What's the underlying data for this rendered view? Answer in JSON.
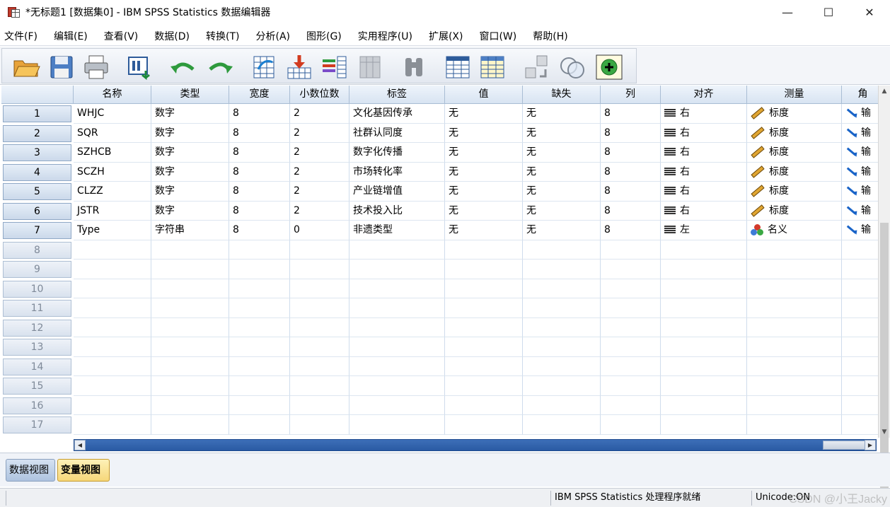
{
  "window": {
    "title": "*无标题1 [数据集0] - IBM SPSS Statistics 数据编辑器",
    "minimize": "—",
    "maximize": "☐",
    "close": "✕"
  },
  "menu": [
    "文件(F)",
    "编辑(E)",
    "查看(V)",
    "数据(D)",
    "转换(T)",
    "分析(A)",
    "图形(G)",
    "实用程序(U)",
    "扩展(X)",
    "窗口(W)",
    "帮助(H)"
  ],
  "toolbar": {
    "icons": [
      "open-folder-icon",
      "save-icon",
      "print-icon",
      "recall-dialog-icon",
      "undo-icon",
      "redo-icon",
      "goto-case-icon",
      "goto-variable-icon",
      "variables-icon",
      "run-descriptives-icon",
      "find-icon",
      "insert-cases-icon",
      "insert-variable-icon",
      "split-file-icon",
      "weight-cases-icon",
      "select-cases-icon",
      "value-labels-icon",
      "use-variable-sets-icon"
    ]
  },
  "grid": {
    "columns": [
      "名称",
      "类型",
      "宽度",
      "小数位数",
      "标签",
      "值",
      "缺失",
      "列",
      "对齐",
      "测量",
      "角"
    ],
    "rows": [
      {
        "num": "1",
        "name": "WHJC",
        "type": "数字",
        "width": "8",
        "decimals": "2",
        "label": "文化基因传承",
        "values": "无",
        "missing": "无",
        "columns": "8",
        "align": "右",
        "measure": "标度",
        "role": "输"
      },
      {
        "num": "2",
        "name": "SQR",
        "type": "数字",
        "width": "8",
        "decimals": "2",
        "label": "社群认同度",
        "values": "无",
        "missing": "无",
        "columns": "8",
        "align": "右",
        "measure": "标度",
        "role": "输"
      },
      {
        "num": "3",
        "name": "SZHCB",
        "type": "数字",
        "width": "8",
        "decimals": "2",
        "label": "数字化传播",
        "values": "无",
        "missing": "无",
        "columns": "8",
        "align": "右",
        "measure": "标度",
        "role": "输"
      },
      {
        "num": "4",
        "name": "SCZH",
        "type": "数字",
        "width": "8",
        "decimals": "2",
        "label": "市场转化率",
        "values": "无",
        "missing": "无",
        "columns": "8",
        "align": "右",
        "measure": "标度",
        "role": "输"
      },
      {
        "num": "5",
        "name": "CLZZ",
        "type": "数字",
        "width": "8",
        "decimals": "2",
        "label": "产业链增值",
        "values": "无",
        "missing": "无",
        "columns": "8",
        "align": "右",
        "measure": "标度",
        "role": "输"
      },
      {
        "num": "6",
        "name": "JSTR",
        "type": "数字",
        "width": "8",
        "decimals": "2",
        "label": "技术投入比",
        "values": "无",
        "missing": "无",
        "columns": "8",
        "align": "右",
        "measure": "标度",
        "role": "输"
      },
      {
        "num": "7",
        "name": "Type",
        "type": "字符串",
        "width": "8",
        "decimals": "0",
        "label": "非遗类型",
        "values": "无",
        "missing": "无",
        "columns": "8",
        "align": "左",
        "measure": "名义",
        "role": "输"
      }
    ],
    "empty_rows": [
      "8",
      "9",
      "10",
      "11",
      "12",
      "13",
      "14",
      "15",
      "16",
      "17"
    ]
  },
  "tabs": {
    "data_view": "数据视图",
    "variable_view": "变量视图"
  },
  "status": {
    "processor": "IBM SPSS Statistics 处理程序就绪",
    "unicode": "Unicode:ON"
  },
  "watermark": "CSDN @小王Jacky"
}
